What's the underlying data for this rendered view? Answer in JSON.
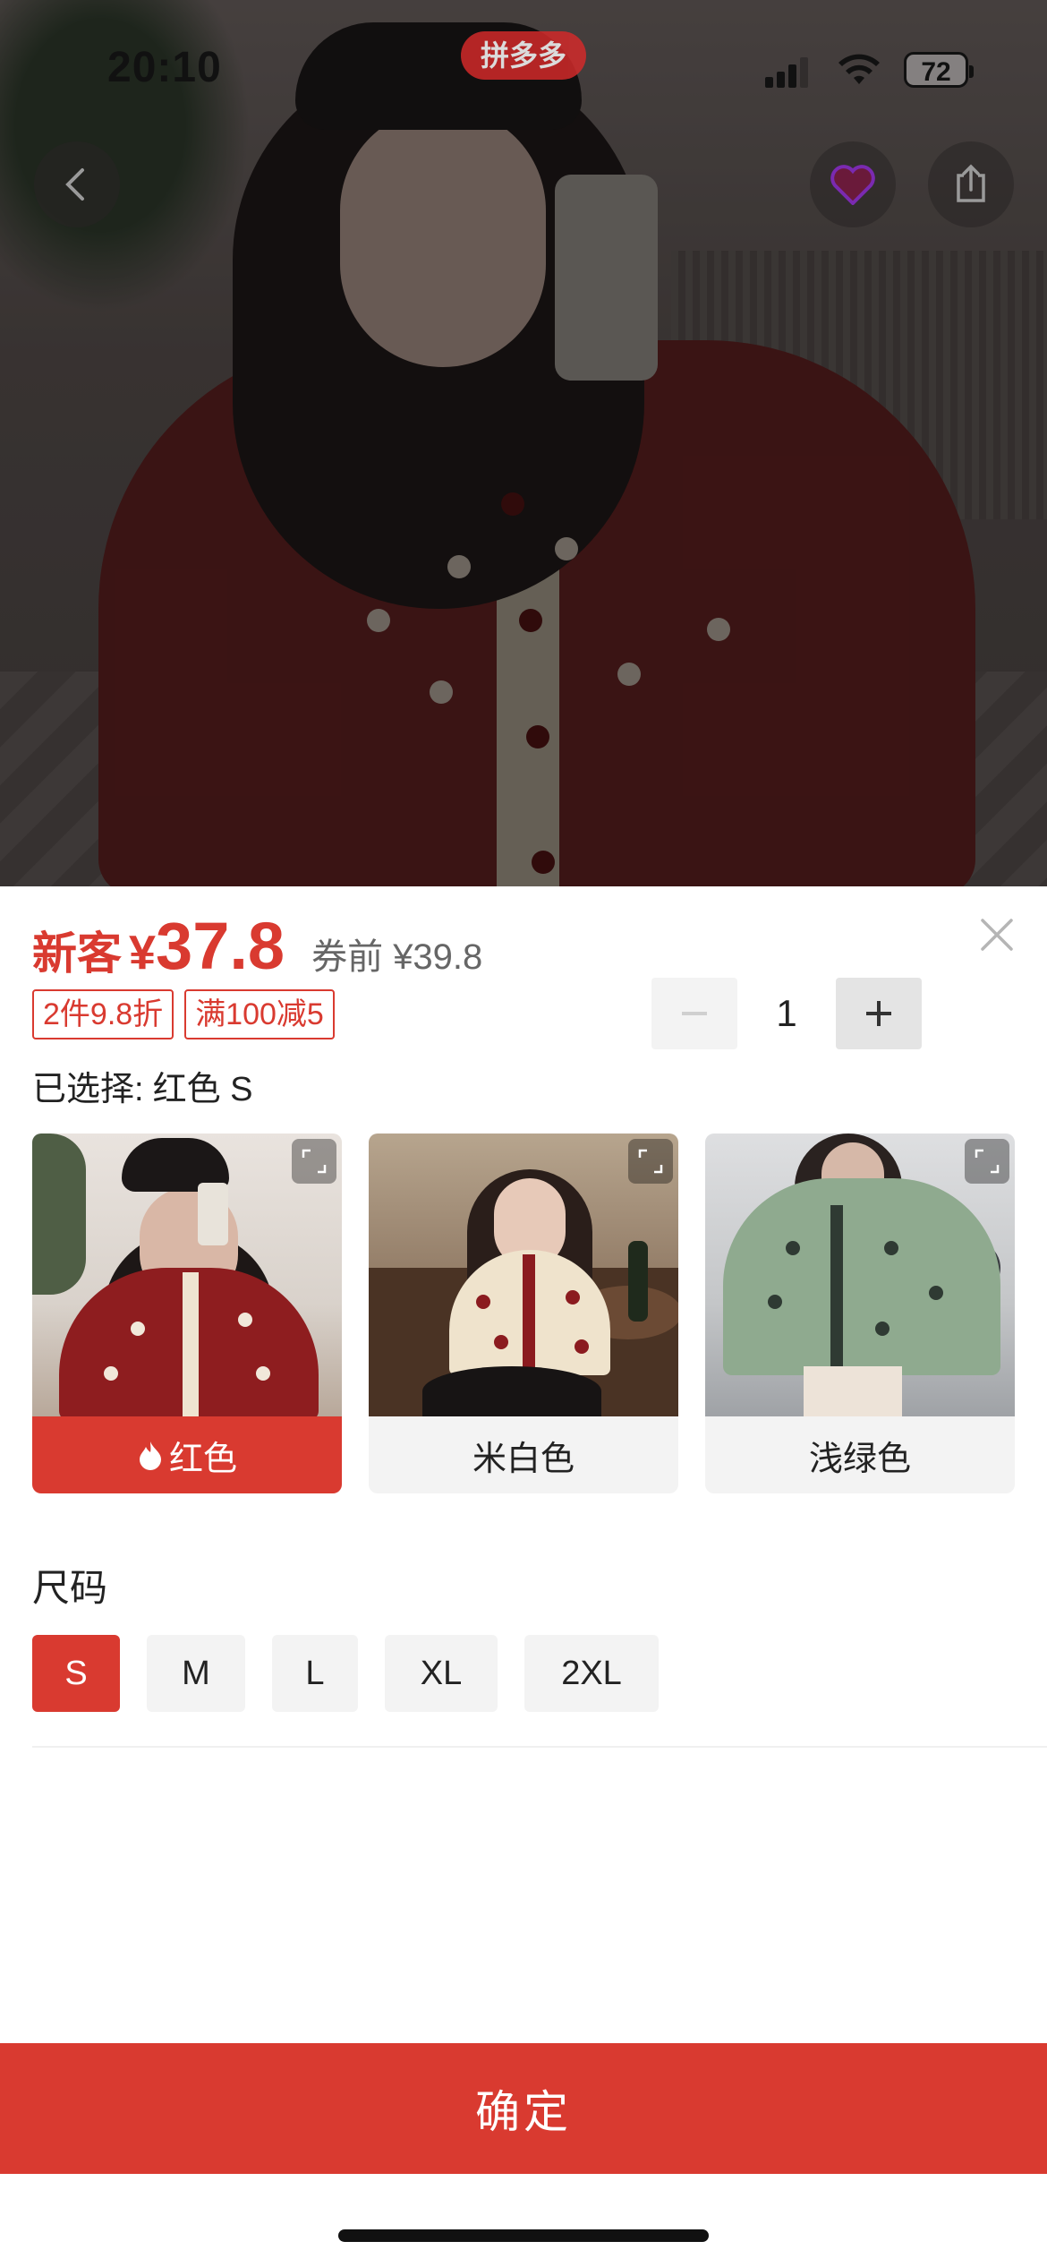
{
  "status_bar": {
    "time": "20:10",
    "battery": "72",
    "brand": "拼多多"
  },
  "price": {
    "newbie_label": "新客",
    "currency": "¥",
    "amount": "37.8",
    "before_label": "券前 ¥39.8"
  },
  "promo_tags": [
    "2件9.8折",
    "满100减5"
  ],
  "quantity": {
    "value": "1",
    "minus_enabled": false
  },
  "selection": {
    "label": "已选择:",
    "value": "红色 S"
  },
  "colors": [
    {
      "label": "红色",
      "selected": true,
      "hot": true
    },
    {
      "label": "米白色",
      "selected": false
    },
    {
      "label": "浅绿色",
      "selected": false
    }
  ],
  "size_section": {
    "title": "尺码",
    "options": [
      "S",
      "M",
      "L",
      "XL",
      "2XL"
    ],
    "selected": "S"
  },
  "confirm_label": "确定",
  "theme": {
    "accent": "#d93a30",
    "chip_bg": "#f3f3f3"
  }
}
